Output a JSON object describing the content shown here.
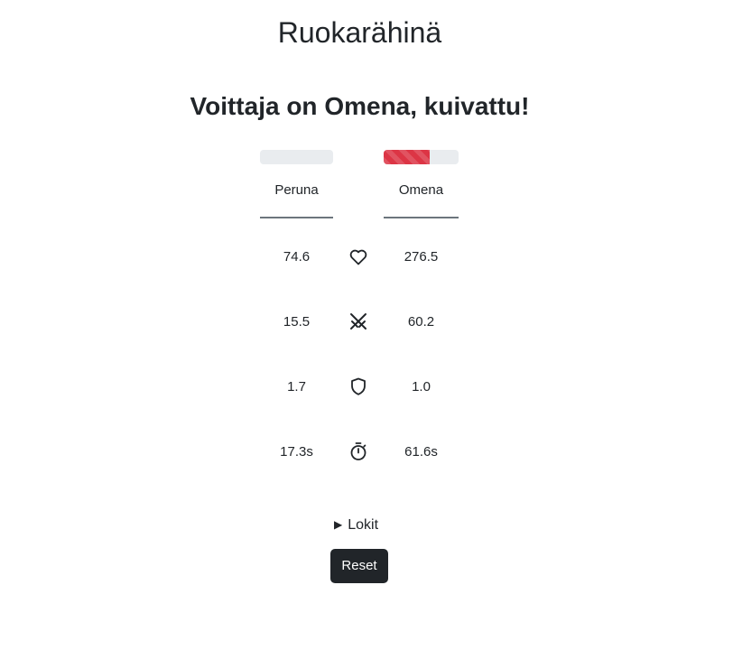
{
  "header": {
    "title": "Ruokarähinä"
  },
  "result": {
    "winner_text": "Voittaja on Omena, kuivattu!"
  },
  "fighters": {
    "left": {
      "name": "Peruna",
      "hp_fraction": 0.0
    },
    "right": {
      "name": "Omena",
      "hp_fraction": 0.62
    }
  },
  "colors": {
    "hp_fill": "#dc3545",
    "hp_track": "#e9ecef",
    "button_bg": "#212529"
  },
  "stats": [
    {
      "icon": "heart-icon",
      "left": "74.6",
      "right": "276.5"
    },
    {
      "icon": "crossed-swords-icon",
      "left": "15.5",
      "right": "60.2"
    },
    {
      "icon": "shield-icon",
      "left": "1.7",
      "right": "1.0"
    },
    {
      "icon": "stopwatch-icon",
      "left": "17.3s",
      "right": "61.6s"
    }
  ],
  "logs": {
    "label": "Lokit"
  },
  "actions": {
    "reset_label": "Reset"
  }
}
